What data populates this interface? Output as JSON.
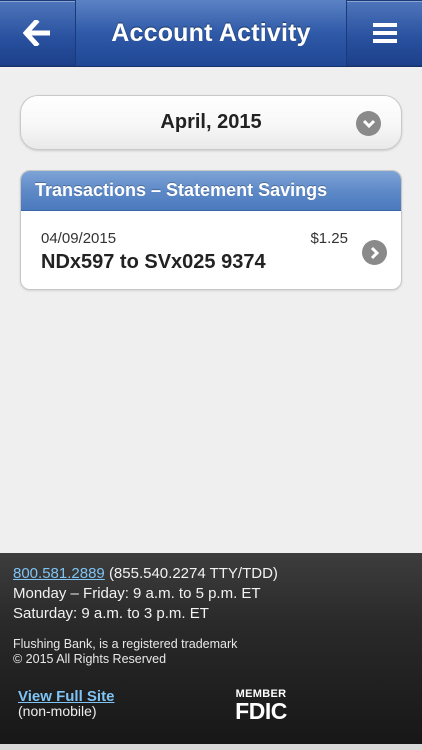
{
  "header": {
    "title": "Account Activity",
    "back_icon": "back-arrow-icon",
    "menu_icon": "hamburger-menu-icon"
  },
  "month_selector": {
    "value": "April, 2015",
    "icon": "chevron-down-icon"
  },
  "transactions": {
    "title": "Transactions – Statement Savings",
    "items": [
      {
        "date": "04/09/2015",
        "amount": "$1.25",
        "description": "NDx597 to SVx025 9374",
        "icon": "chevron-right-icon"
      }
    ]
  },
  "footer": {
    "phone": "800.581.2889",
    "tty": "(855.540.2274 TTY/TDD)",
    "hours_weekday": "Monday – Friday: 9 a.m. to 5 p.m. ET",
    "hours_saturday": "Saturday: 9 a.m. to 3 p.m. ET",
    "trademark": "Flushing Bank, is a registered trademark",
    "copyright": "© 2015 All Rights Reserved",
    "view_full_site": "View Full Site",
    "non_mobile": "(non-mobile)",
    "fdic_member": "MEMBER",
    "fdic": "FDIC"
  },
  "colors": {
    "header_blue": "#2f5aa8",
    "card_header_blue": "#5f8ac8",
    "link_blue": "#7fc4f5",
    "footer_dark": "#2a2a2a"
  }
}
